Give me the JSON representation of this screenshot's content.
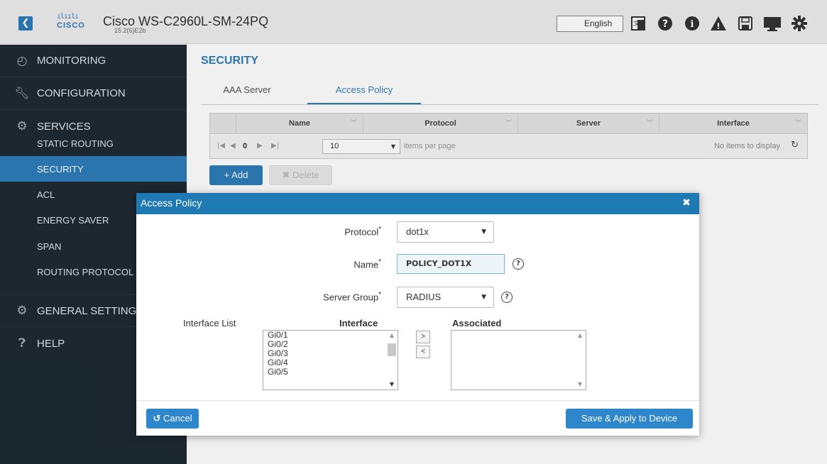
{
  "header": {
    "back_icon": "back-arrow-icon",
    "logo_bars": "ılıılı",
    "logo_word": "CISCO",
    "device_title": "Cisco WS-C2960L-SM-24PQ",
    "device_version": "15.2(6)E2b",
    "language": "English",
    "icons": [
      "language-icon",
      "help-icon",
      "info-icon",
      "alert-icon",
      "save-icon",
      "monitor-icon",
      "settings-gear-icon"
    ]
  },
  "sidebar": {
    "monitoring": "MONITORING",
    "configuration": "CONFIGURATION",
    "services": "SERVICES",
    "items": [
      "STATIC ROUTING",
      "SECURITY",
      "ACL",
      "ENERGY SAVER",
      "SPAN",
      "ROUTING PROTOCOL"
    ],
    "active_item": "SECURITY",
    "general_setting": "GENERAL SETTING",
    "help": "HELP"
  },
  "main": {
    "page_title": "SECURITY",
    "tabs": [
      {
        "label": "AAA Server",
        "active": false
      },
      {
        "label": "Access Policy",
        "active": true
      }
    ],
    "grid": {
      "columns": [
        "Name",
        "Protocol",
        "Server",
        "Interface"
      ],
      "page_number": "0",
      "items_per_page": "10",
      "items_per_page_label": "items per page",
      "empty_text": "No items to display"
    },
    "add_button": "+ Add",
    "delete_button": "✖ Delete"
  },
  "modal": {
    "title": "Access Policy",
    "protocol_label": "Protocol",
    "protocol_value": "dot1x",
    "name_label": "Name",
    "name_value": "POLICY_DOT1X",
    "server_group_label": "Server Group",
    "server_group_value": "RADIUS",
    "required_mark": "*",
    "interface_list_label": "Interface List",
    "interface_header": "Interface",
    "associated_header": "Associated",
    "interfaces": [
      "Gi0/1",
      "Gi0/2",
      "Gi0/3",
      "Gi0/4",
      "Gi0/5"
    ],
    "associated": [],
    "move_right": ">",
    "move_left": "<",
    "cancel_button": "Cancel",
    "save_button": "Save & Apply to Device"
  },
  "colors": {
    "accent": "#2e7db9",
    "sidebar_bg": "#1e2a33",
    "modal_header": "#1f7ab4"
  }
}
